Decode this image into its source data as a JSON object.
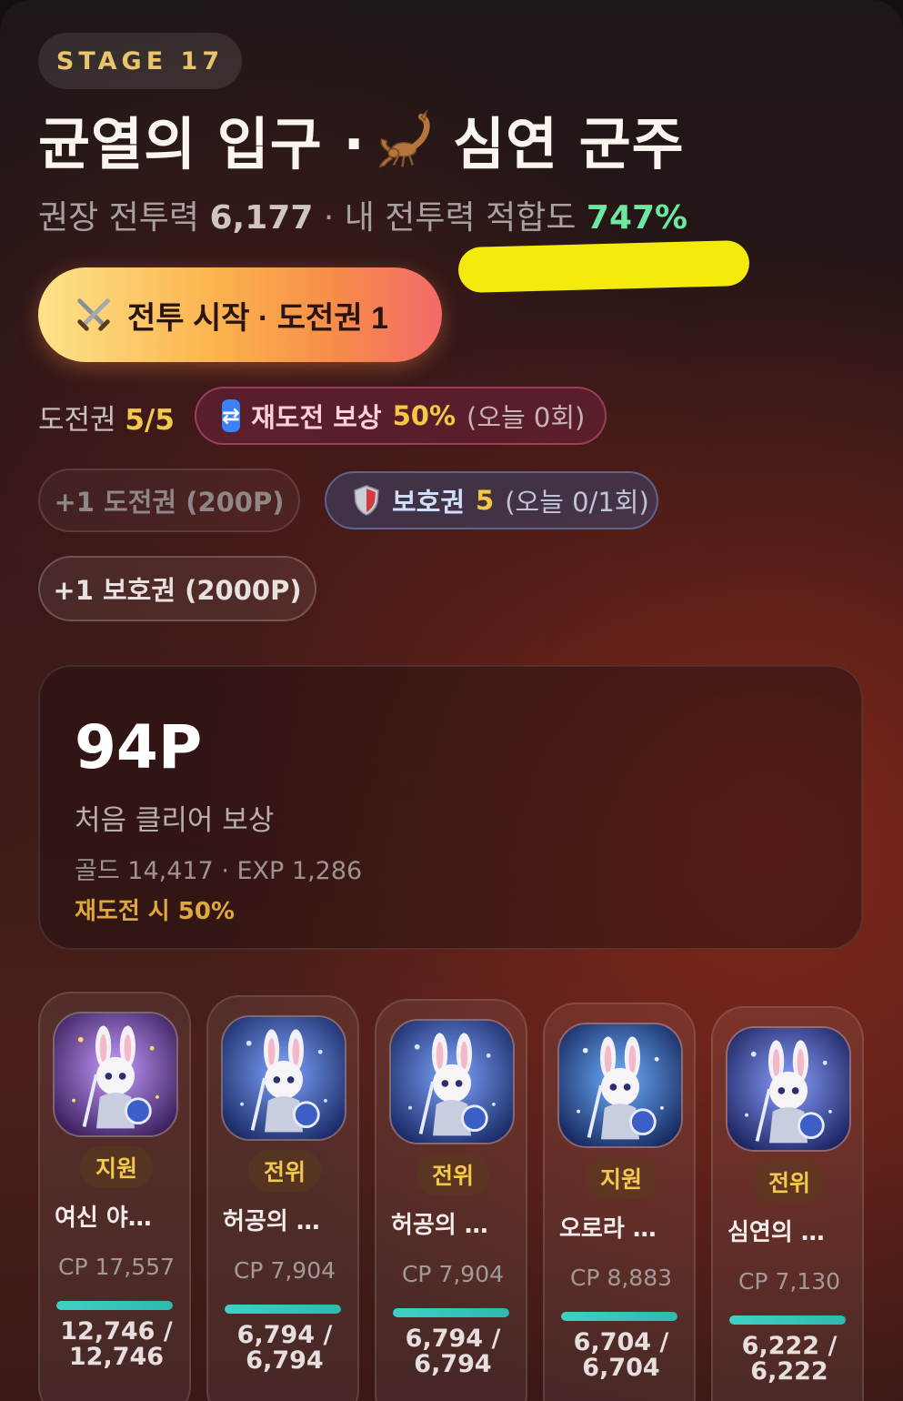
{
  "stage": {
    "label": "STAGE 17"
  },
  "title": {
    "left": "균열의 입구 ·",
    "right": "심연 군주"
  },
  "subtitle": {
    "rec_label": "권장 전투력",
    "rec_value": "6,177",
    "fit_label": "· 내 전투력 적합도",
    "fit_value": "747%"
  },
  "start_button": {
    "label": "전투 시작 · 도전권 1"
  },
  "tickets": {
    "label": "도전권",
    "value": "5/5"
  },
  "retry_reward": {
    "label": "재도전 보상",
    "value": "50%",
    "note": "(오늘 0회)"
  },
  "buy_ticket": {
    "label": "+1 도전권 (200P)"
  },
  "shield": {
    "label": "보호권",
    "value": "5",
    "note": "(오늘 0/1회)"
  },
  "buy_shield": {
    "label": "+1 보호권 (2000P)"
  },
  "reward": {
    "points": "94P",
    "label": "처음 클리어 보상",
    "detail": "골드 14,417 · EXP 1,286",
    "retry_note": "재도전 시 50%"
  },
  "units": [
    {
      "role": "지원",
      "name": "여신 야…",
      "cp": "CP 17,557",
      "hp": "12,746 /",
      "hp_max": "12,746",
      "hp_ratio": 1.0
    },
    {
      "role": "전위",
      "name": "허공의 …",
      "cp": "CP 7,904",
      "hp": "6,794 /",
      "hp_max": "6,794",
      "hp_ratio": 1.0
    },
    {
      "role": "전위",
      "name": "허공의 …",
      "cp": "CP 7,904",
      "hp": "6,794 /",
      "hp_max": "6,794",
      "hp_ratio": 1.0
    },
    {
      "role": "지원",
      "name": "오로라 …",
      "cp": "CP 8,883",
      "hp": "6,704 /",
      "hp_max": "6,704",
      "hp_ratio": 1.0
    },
    {
      "role": "전위",
      "name": "심연의 …",
      "cp": "CP 7,130",
      "hp": "6,222 /",
      "hp_max": "6,222",
      "hp_ratio": 1.0
    }
  ],
  "icons": {
    "title": "scorpion-icon",
    "start": "crossed-swords-icon",
    "retry": "repeat-icon",
    "shield": "shield-icon"
  },
  "colors": {
    "accent_gold": "#f2c94c",
    "fit_green": "#6ee7a0",
    "hp_bar": "#3fd0c4",
    "highlight": "#f4ea0b"
  }
}
